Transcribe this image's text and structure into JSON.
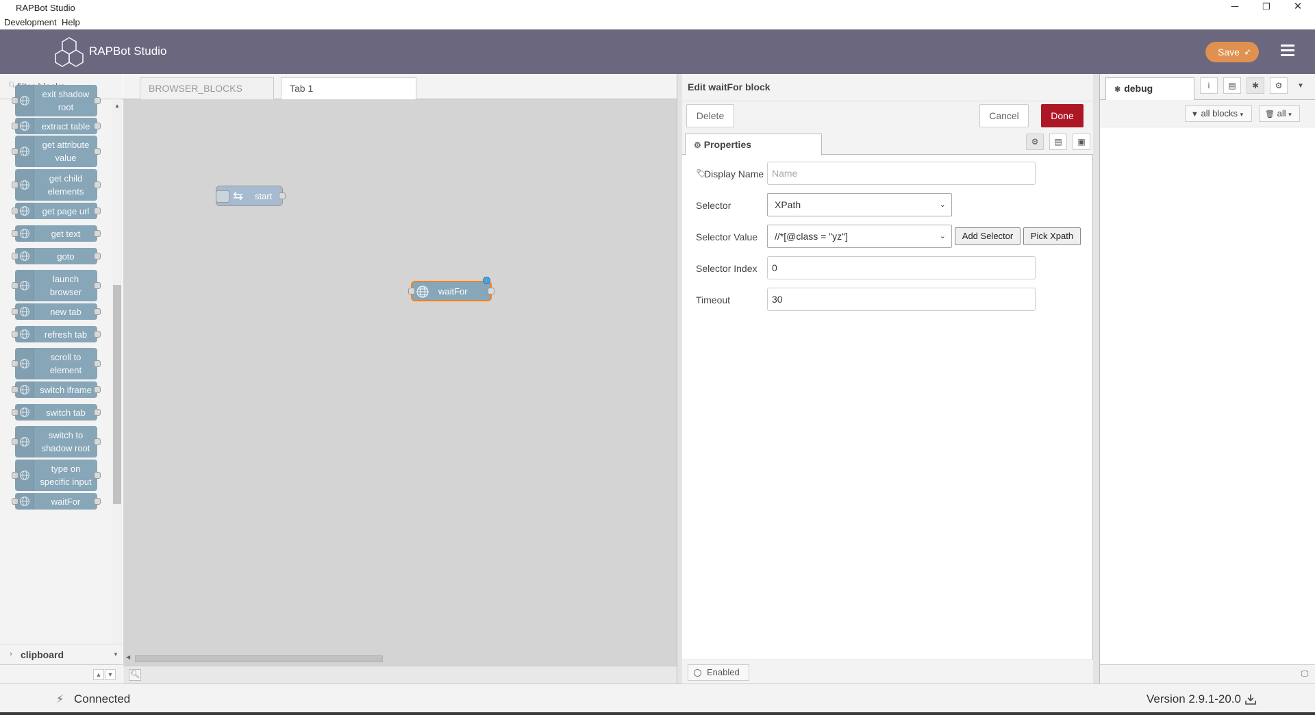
{
  "window": {
    "title": "RAPBot Studio",
    "minimize": "─",
    "restore": "❐",
    "close": "✕"
  },
  "menu": [
    "Development",
    "Help"
  ],
  "header": {
    "brand": "RAPBot Studio",
    "save_label": "Save"
  },
  "palette": {
    "filter_placeholder": "filter blocks",
    "nodes": [
      "exit shadow root",
      "extract table",
      "get attribute value",
      "get child elements",
      "get page url",
      "get text",
      "goto",
      "launch browser",
      "new tab",
      "refresh tab",
      "scroll to element",
      "switch iframe",
      "switch tab",
      "switch to shadow root",
      "type on specific input",
      "waitFor"
    ],
    "category": "clipboard"
  },
  "workspace": {
    "tabs": [
      "BROWSER_BLOCKS",
      "Tab 1"
    ],
    "nodes": {
      "start": "start",
      "waitfor": "waitFor"
    }
  },
  "tray": {
    "title": "Edit waitFor block",
    "delete_label": "Delete",
    "cancel_label": "Cancel",
    "done_label": "Done",
    "properties_tab": "Properties",
    "display_name_label": "Display Name",
    "display_name_placeholder": "Name",
    "selector_label": "Selector",
    "selector_value": "XPath",
    "selector_value_label": "Selector Value",
    "selector_value_value": "//*[@class = \"yz\"]",
    "add_selector_label": "Add Selector",
    "pick_xpath_label": "Pick Xpath",
    "selector_index_label": "Selector Index",
    "selector_index_value": "0",
    "timeout_label": "Timeout",
    "timeout_value": "30",
    "enabled_label": "Enabled"
  },
  "sidebar": {
    "tab_label": "debug",
    "filter_label": "all blocks",
    "clear_label": "all"
  },
  "status": {
    "connection": "Connected",
    "version": "Version 2.9.1-20.0"
  },
  "colors": {
    "header": "#6a677f",
    "save": "#e0914f",
    "done": "#ad1625",
    "node": "#87a6b8",
    "canvas": "#d4d4d4"
  }
}
